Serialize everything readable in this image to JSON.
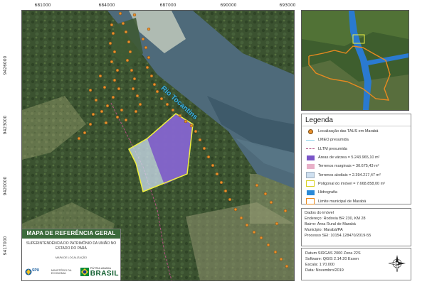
{
  "coords": {
    "top": [
      "681000",
      "684000",
      "687000",
      "690000",
      "693000"
    ],
    "left": [
      "9426000",
      "9423000",
      "9420000",
      "9417000"
    ]
  },
  "river_label": "Rio Tocantins",
  "legend": {
    "title": "Legenda",
    "items": [
      {
        "label": "Localização das TAUS em Marabá",
        "symbol": "dot"
      },
      {
        "label": "LMEO presumida",
        "symbol": "line",
        "color": "#8fd0e8"
      },
      {
        "label": "LLTM presumida",
        "symbol": "dash",
        "color": "#b05080"
      },
      {
        "label": "Áreas de várzea = 5.243.965,10 m²",
        "symbol": "box",
        "color": "#7a55c8"
      },
      {
        "label": "Terrenos marginais = 30.675,43 m²",
        "symbol": "box",
        "color": "#e8b0c8"
      },
      {
        "label": "Terrenos alodiais = 2.394.217,47 m²",
        "symbol": "box",
        "color": "#cfe0f0"
      },
      {
        "label": "Poligonal do imóvel = 7.668.858,00 m²",
        "symbol": "outline",
        "color": "#f0f040"
      },
      {
        "label": "Hidrografia",
        "symbol": "box",
        "color": "#2a8ad8"
      },
      {
        "label": "Limite municipal de Marabá",
        "symbol": "outline",
        "color": "#e88a20"
      }
    ]
  },
  "info": {
    "title": "Dados do imóvel",
    "lines": [
      "Endereço: Rodovia BR 230, KM 28",
      "Bairro: Área Rural de Marabá",
      "Município: Marabá/PA",
      "Processo SEI: 10154.128470/2019-55"
    ]
  },
  "datum": {
    "lines": [
      "Datum SIRGAS 2000 Zona 22S",
      "Software: QGIS 2.14.20 Essen",
      "Escala: 1:70.000",
      "Data: Novembro/2019"
    ]
  },
  "title_box": {
    "main": "MAPA DE REFERÊNCIA GERAL",
    "sub": "SUPERINTENDÊNCIA DO PATRIMÔNIO DA UNIÃO NO ESTADO DO PARÁ",
    "small": "MAPA DE LOCALIZAÇÃO",
    "logo_spu": "SPU",
    "logo_ministry": "MINISTÉRIO DA ECONOMIA",
    "logo_brasil_small": "PÁTRIA AMADA",
    "logo_brasil_big": "BRASIL"
  },
  "colors": {
    "taus_dot": "#e8912e",
    "varzea": "#7a55c8",
    "alodial": "#cfe0f0",
    "poligonal": "#f0f040",
    "river": "#4a6a80",
    "river_label": "#3ab0e0"
  },
  "icons": {
    "north_arrow": "north-arrow-icon"
  }
}
